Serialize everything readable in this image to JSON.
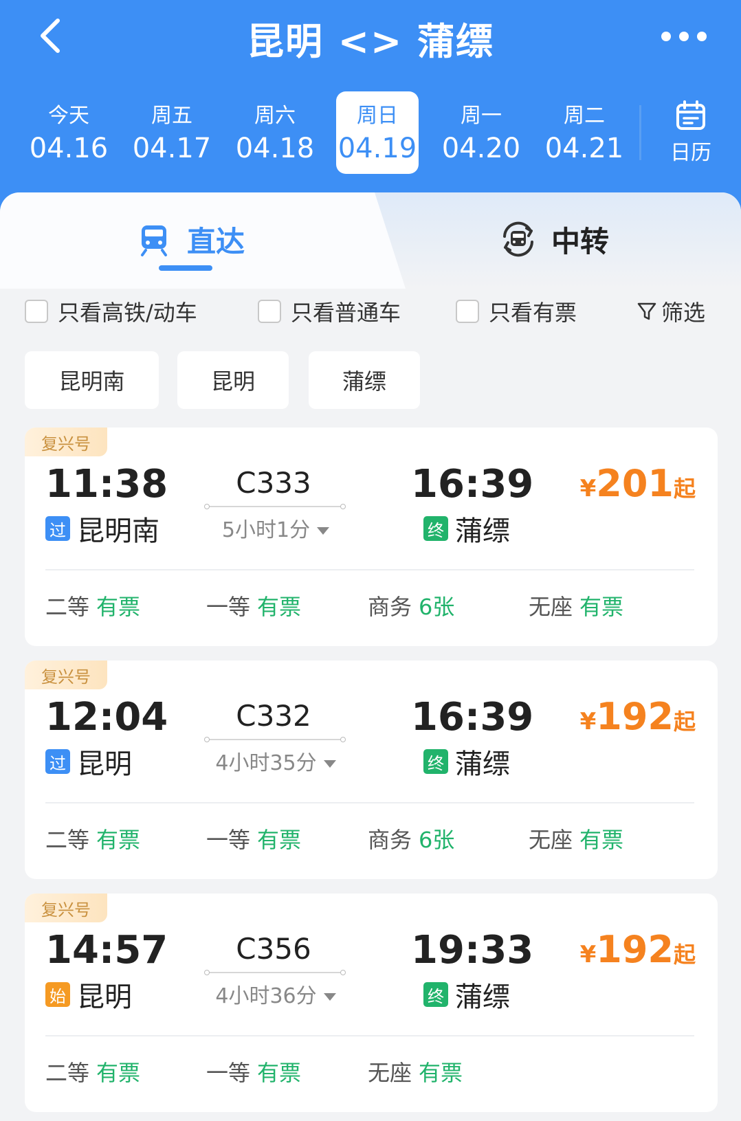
{
  "header": {
    "title": "昆明 <> 蒲缥",
    "dates": [
      {
        "weekday": "今天",
        "date": "04.16"
      },
      {
        "weekday": "周五",
        "date": "04.17"
      },
      {
        "weekday": "周六",
        "date": "04.18"
      },
      {
        "weekday": "周日",
        "date": "04.19"
      },
      {
        "weekday": "周一",
        "date": "04.20"
      },
      {
        "weekday": "周二",
        "date": "04.21"
      }
    ],
    "selected_index": 3,
    "calendar_label": "日历"
  },
  "tabs": {
    "direct": "直达",
    "transfer": "中转"
  },
  "filters": {
    "high_speed": "只看高铁/动车",
    "normal": "只看普通车",
    "available": "只看有票",
    "filter": "筛选"
  },
  "station_chips": [
    "昆明南",
    "昆明",
    "蒲缥"
  ],
  "trains": [
    {
      "brand": "复兴号",
      "dep_time": "11:38",
      "dep_badge": "过",
      "dep_station": "昆明南",
      "train_no": "C333",
      "duration": "5小时1分",
      "arr_time": "16:39",
      "arr_badge": "终",
      "arr_station": "蒲缥",
      "price_symbol": "¥",
      "price": "201",
      "price_suffix": "起",
      "seats": [
        {
          "class": "二等",
          "status": "有票"
        },
        {
          "class": "一等",
          "status": "有票"
        },
        {
          "class": "商务",
          "status": "6张"
        },
        {
          "class": "无座",
          "status": "有票"
        }
      ]
    },
    {
      "brand": "复兴号",
      "dep_time": "12:04",
      "dep_badge": "过",
      "dep_station": "昆明",
      "train_no": "C332",
      "duration": "4小时35分",
      "arr_time": "16:39",
      "arr_badge": "终",
      "arr_station": "蒲缥",
      "price_symbol": "¥",
      "price": "192",
      "price_suffix": "起",
      "seats": [
        {
          "class": "二等",
          "status": "有票"
        },
        {
          "class": "一等",
          "status": "有票"
        },
        {
          "class": "商务",
          "status": "6张"
        },
        {
          "class": "无座",
          "status": "有票"
        }
      ]
    },
    {
      "brand": "复兴号",
      "dep_time": "14:57",
      "dep_badge": "始",
      "dep_station": "昆明",
      "train_no": "C356",
      "duration": "4小时36分",
      "arr_time": "19:33",
      "arr_badge": "终",
      "arr_station": "蒲缥",
      "price_symbol": "¥",
      "price": "192",
      "price_suffix": "起",
      "seats": [
        {
          "class": "二等",
          "status": "有票"
        },
        {
          "class": "一等",
          "status": "有票"
        },
        {
          "class": "无座",
          "status": "有票"
        }
      ]
    }
  ],
  "colors": {
    "primary": "#3d8ff5",
    "price": "#f5821f",
    "available": "#21b36b",
    "brand_tag": "#c9913f",
    "badge_start": "#f59a23"
  }
}
